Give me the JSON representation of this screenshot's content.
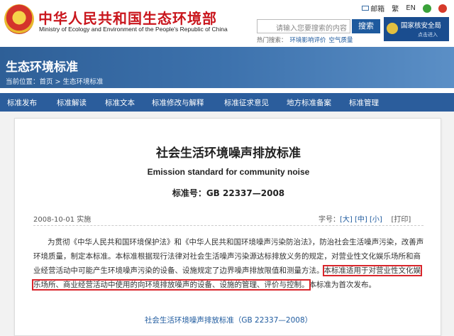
{
  "header": {
    "site_cn": "中华人民共和国生态环境部",
    "site_en": "Ministry of Ecology and Environment of the People's Republic of China",
    "links": {
      "mail": "邮箱",
      "traditional": "繁",
      "english": "EN"
    },
    "search": {
      "placeholder": "请输入您要搜索的内容",
      "button": "搜索"
    },
    "hot": {
      "label": "热门搜索：",
      "items": [
        "环境影响评价",
        "空气质量"
      ]
    },
    "nnsa": {
      "title": "国家核安全局",
      "sub": "点击进入"
    }
  },
  "banner": {
    "title": "生态环境标准",
    "breadcrumb": "当前位置：首页 > 生态环境标准"
  },
  "nav": [
    "标准发布",
    "标准解读",
    "标准文本",
    "标准修改与解释",
    "标准征求意见",
    "地方标准备案",
    "标准管理"
  ],
  "doc": {
    "title": "社会生活环境噪声排放标准",
    "title_en": "Emission standard for community noise",
    "number": "标准号：GB 22337—2008",
    "date": "2008-10-01 实施",
    "fontsize": {
      "label": "字号：",
      "large": "[大]",
      "medium": "[中]",
      "small": "[小]",
      "print": "[打印]"
    },
    "para_a": "为贯彻《中华人民共和国环境保护法》和《中华人民共和国环境噪声污染防治法》，防治社会生活噪声污染，改善声环境质量，制定本标准。本标准根据现行法律对社会生活噪声污染源达标排放义务的规定，对营业性文化娱乐场所和商业经营活动中可能产生环境噪声污染的设备、设施规定了边界噪声排放限值和测量方法。",
    "para_hl": "本标准适用于对营业性文化娱乐场所、商业经营活动中使用的向环境排放噪声的设备、设施的管理、评价与控制。",
    "para_b": "本标准为首次发布。",
    "link": "社会生活环境噪声排放标准（GB 22337—2008）"
  }
}
